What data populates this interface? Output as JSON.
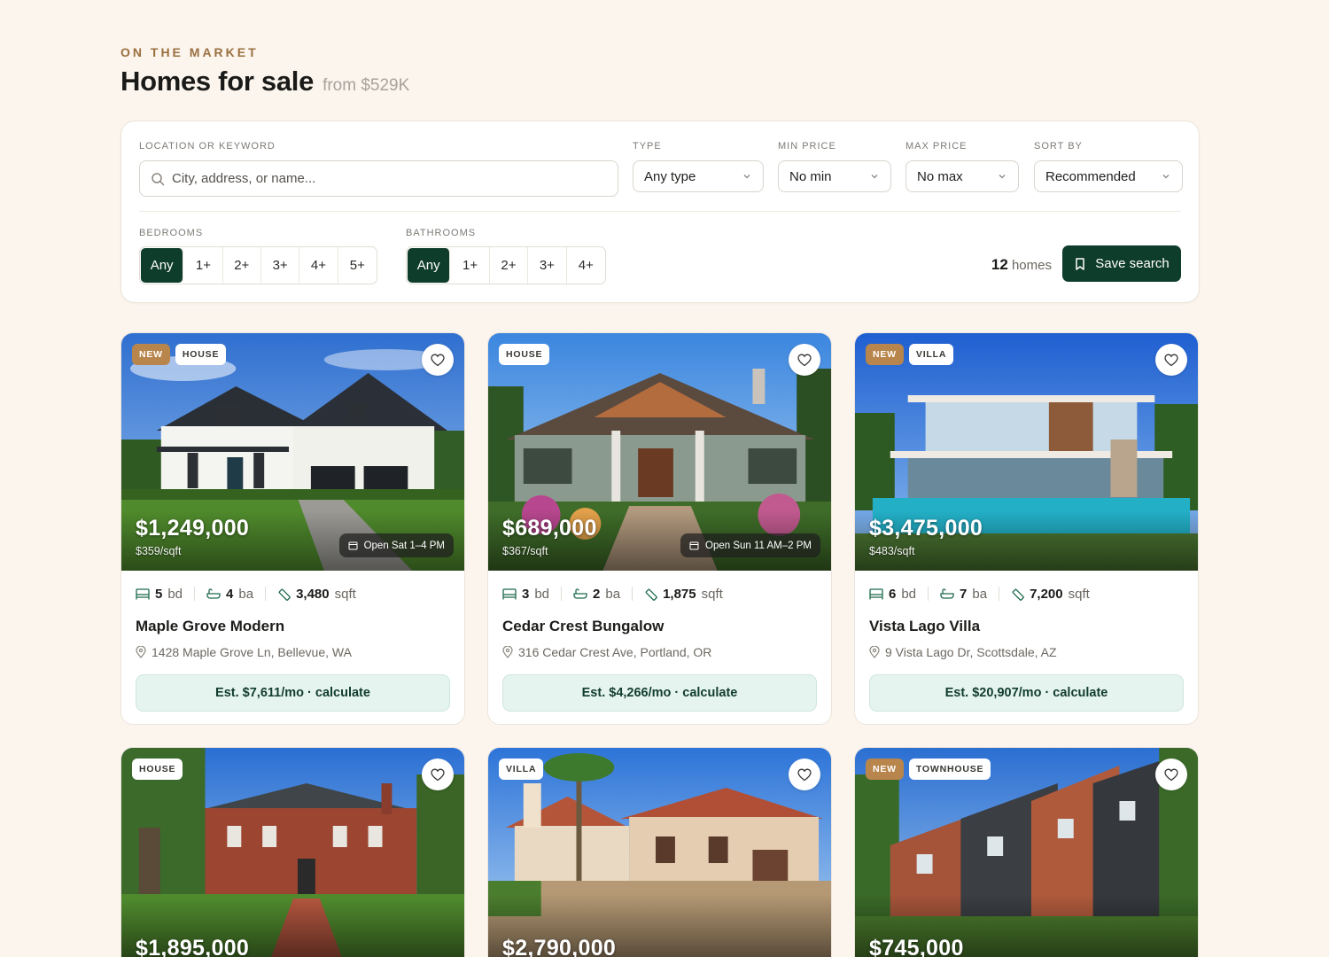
{
  "header": {
    "eyebrow": "ON THE MARKET",
    "title": "Homes for sale",
    "subtitle": "from $529K"
  },
  "filters": {
    "location_label": "LOCATION OR KEYWORD",
    "location_placeholder": "City, address, or name...",
    "type_label": "TYPE",
    "type_value": "Any type",
    "min_price_label": "MIN PRICE",
    "min_price_value": "No min",
    "max_price_label": "MAX PRICE",
    "max_price_value": "No max",
    "sort_label": "SORT BY",
    "sort_value": "Recommended",
    "bedrooms_label": "BEDROOMS",
    "bedrooms_options": [
      "Any",
      "1+",
      "2+",
      "3+",
      "4+",
      "5+"
    ],
    "bedrooms_selected": "Any",
    "bathrooms_label": "BATHROOMS",
    "bathrooms_options": [
      "Any",
      "1+",
      "2+",
      "3+",
      "4+"
    ],
    "bathrooms_selected": "Any",
    "count_number": "12",
    "count_label": "homes",
    "save_button": "Save search"
  },
  "colors": {
    "accent_green": "#0f3d2c",
    "accent_gold": "#b8854c",
    "estimate_bg": "#e5f4ee"
  },
  "listings": [
    {
      "badge_new": "NEW",
      "badge_type": "HOUSE",
      "price": "$1,249,000",
      "price_per_sqft": "$359/sqft",
      "open_house": "Open Sat 1–4 PM",
      "beds": "5",
      "beds_unit": "bd",
      "baths": "4",
      "baths_unit": "ba",
      "sqft": "3,480",
      "sqft_unit": "sqft",
      "name": "Maple Grove Modern",
      "address": "1428 Maple Grove Ln, Bellevue, WA",
      "estimate": "Est. $7,611/mo · calculate"
    },
    {
      "badge_new": "",
      "badge_type": "HOUSE",
      "price": "$689,000",
      "price_per_sqft": "$367/sqft",
      "open_house": "Open Sun 11 AM–2 PM",
      "beds": "3",
      "beds_unit": "bd",
      "baths": "2",
      "baths_unit": "ba",
      "sqft": "1,875",
      "sqft_unit": "sqft",
      "name": "Cedar Crest Bungalow",
      "address": "316 Cedar Crest Ave, Portland, OR",
      "estimate": "Est. $4,266/mo · calculate"
    },
    {
      "badge_new": "NEW",
      "badge_type": "VILLA",
      "price": "$3,475,000",
      "price_per_sqft": "$483/sqft",
      "open_house": "",
      "beds": "6",
      "beds_unit": "bd",
      "baths": "7",
      "baths_unit": "ba",
      "sqft": "7,200",
      "sqft_unit": "sqft",
      "name": "Vista Lago Villa",
      "address": "9 Vista Lago Dr, Scottsdale, AZ",
      "estimate": "Est. $20,907/mo · calculate"
    },
    {
      "badge_new": "",
      "badge_type": "HOUSE",
      "price": "$1,895,000"
    },
    {
      "badge_new": "",
      "badge_type": "VILLA",
      "price": "$2,790,000"
    },
    {
      "badge_new": "NEW",
      "badge_type": "TOWNHOUSE",
      "price": "$745,000"
    }
  ]
}
